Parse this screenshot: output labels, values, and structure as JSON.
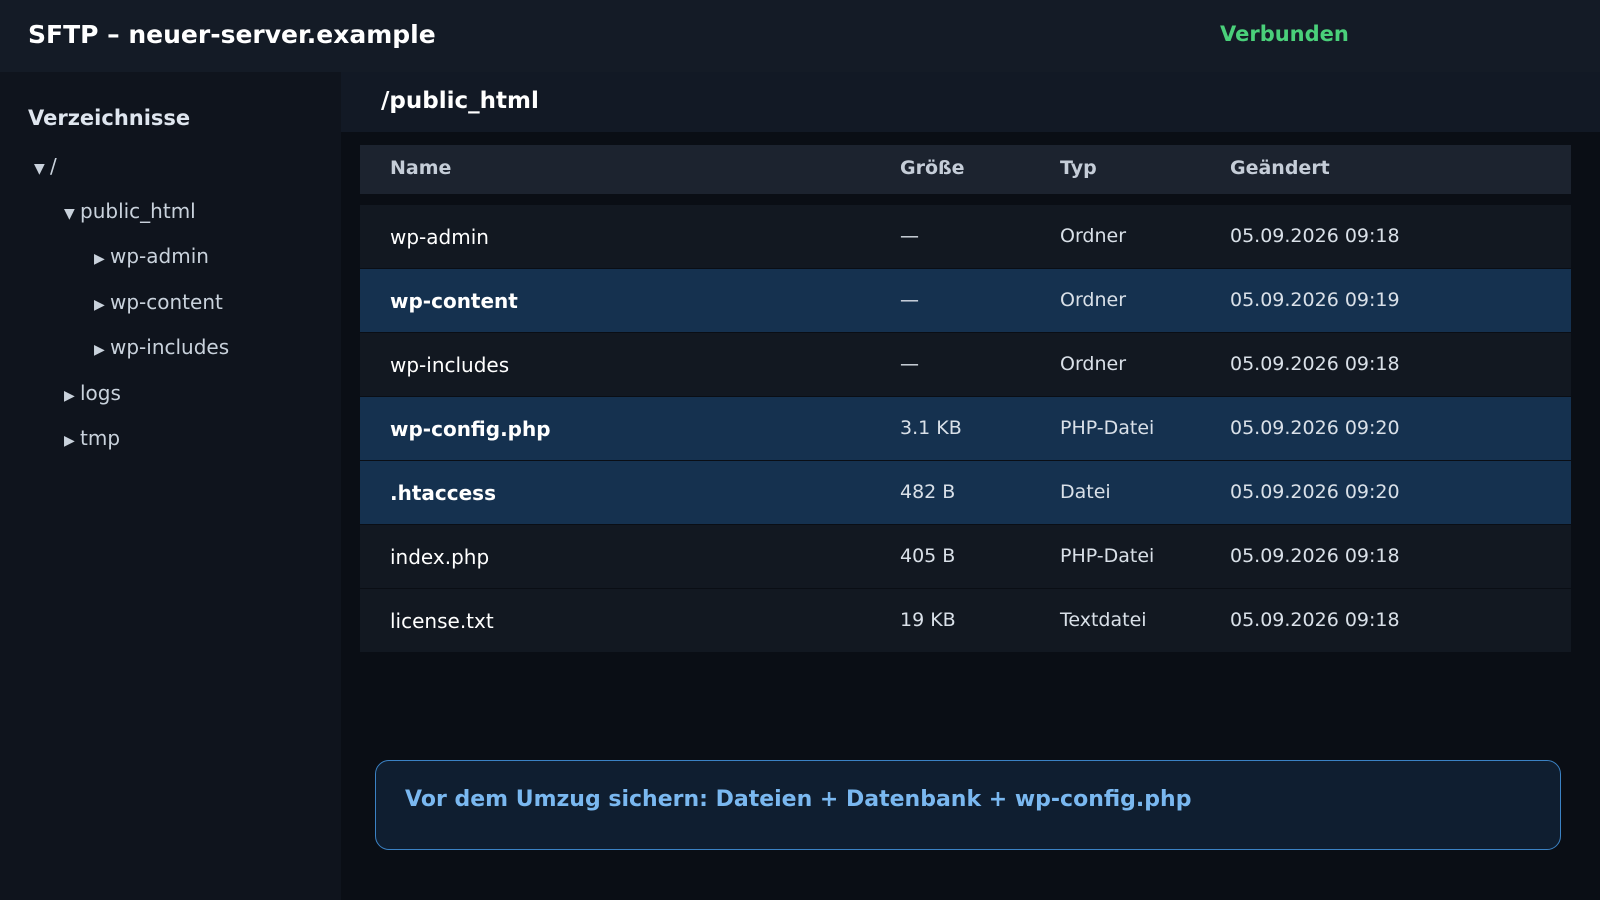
{
  "header": {
    "title": "SFTP – neuer-server.example",
    "status": "Verbunden",
    "status_color": "#4ad07a"
  },
  "sidebar": {
    "title": "Verzeichnisse",
    "tree": [
      {
        "label": "/",
        "caret": "▼",
        "expanded": true
      },
      {
        "label": "public_html",
        "caret": "▼",
        "expanded": true
      },
      {
        "label": "wp-admin",
        "caret": "▶",
        "expanded": false
      },
      {
        "label": "wp-content",
        "caret": "▶",
        "expanded": false
      },
      {
        "label": "wp-includes",
        "caret": "▶",
        "expanded": false
      },
      {
        "label": "logs",
        "caret": "▶",
        "expanded": false
      },
      {
        "label": "tmp",
        "caret": "▶",
        "expanded": false
      }
    ]
  },
  "main": {
    "path": "/public_html",
    "columns": {
      "name": "Name",
      "size": "Größe",
      "type": "Typ",
      "modified": "Geändert"
    },
    "rows": [
      {
        "name": "wp-admin",
        "size": "—",
        "type": "Ordner",
        "modified": "05.09.2026 09:18",
        "selected": false
      },
      {
        "name": "wp-content",
        "size": "—",
        "type": "Ordner",
        "modified": "05.09.2026 09:19",
        "selected": true
      },
      {
        "name": "wp-includes",
        "size": "—",
        "type": "Ordner",
        "modified": "05.09.2026 09:18",
        "selected": false
      },
      {
        "name": "wp-config.php",
        "size": "3.1 KB",
        "type": "PHP-Datei",
        "modified": "05.09.2026 09:20",
        "selected": true
      },
      {
        "name": ".htaccess",
        "size": "482 B",
        "type": "Datei",
        "modified": "05.09.2026 09:20",
        "selected": true
      },
      {
        "name": "index.php",
        "size": "405 B",
        "type": "PHP-Datei",
        "modified": "05.09.2026 09:18",
        "selected": false
      },
      {
        "name": "license.txt",
        "size": "19 KB",
        "type": "Textdatei",
        "modified": "05.09.2026 09:18",
        "selected": false
      }
    ]
  },
  "note": {
    "text": "Vor dem Umzug sichern: Dateien + Datenbank + wp-config.php",
    "accent": "#3b82c4"
  }
}
